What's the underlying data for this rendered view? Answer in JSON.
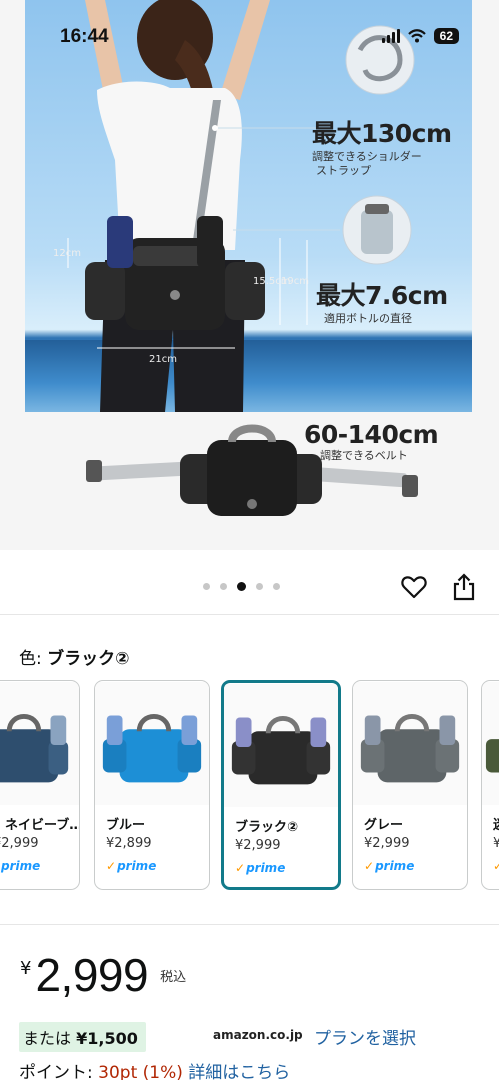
{
  "status_bar": {
    "time": "16:44",
    "battery": "62"
  },
  "hero": {
    "spec_strap": {
      "value": "最大130cm",
      "desc_line1": "調整できるショルダー",
      "desc_line2": "ストラップ"
    },
    "spec_bottle": {
      "value": "最大7.6cm",
      "desc": "適用ボトルの直径"
    },
    "spec_belt": {
      "value": "60-140cm",
      "desc": "調整できるベルト"
    },
    "dims": {
      "pocket_height": "12cm",
      "bag_height_inner": "15.5cm",
      "bag_height": "19cm",
      "bag_width": "21cm"
    }
  },
  "pager": {
    "count": 5,
    "active_index": 2
  },
  "color": {
    "label": "色: ",
    "selected": "ブラック②"
  },
  "variants": [
    {
      "name": "ネイビーブ…",
      "price": "¥2,999",
      "prime": "prime",
      "color": "#2e4e6e"
    },
    {
      "name": "ブルー",
      "price": "¥2,899",
      "prime": "prime",
      "color": "#1d8fd6"
    },
    {
      "name": "ブラック②",
      "price": "¥2,999",
      "prime": "prime",
      "color": "#2a2a2a"
    },
    {
      "name": "グレー",
      "price": "¥2,999",
      "prime": "prime",
      "color": "#5e6568"
    },
    {
      "name": "迷",
      "price": "¥",
      "prime": "",
      "color": "#4a5a3a"
    }
  ],
  "price": {
    "currency": "¥",
    "amount": "2,999",
    "tax_label": "税込"
  },
  "plan": {
    "prefix": "または",
    "amount": "¥1,500",
    "source": "amazon.co.jp",
    "link": "プランを選択"
  },
  "points": {
    "label": "ポイント: ",
    "value": "30pt",
    "percent": "(1%)",
    "link": "詳細はこちら"
  },
  "colors": {
    "selected_border": "#127a8a",
    "link": "#2162a1",
    "price_red": "#b12704",
    "prime_blue": "#1a98ff",
    "plan_bg": "#dff3e4"
  }
}
